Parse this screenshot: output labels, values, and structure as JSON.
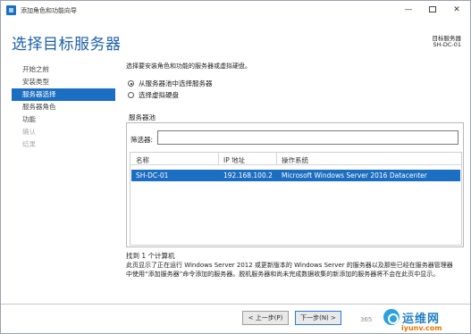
{
  "window": {
    "title": "添加角色和功能向导",
    "minimize": "—",
    "close": "✕"
  },
  "header": {
    "title": "选择目标服务器",
    "target_label": "目标服务器",
    "target_server": "SH-DC-01"
  },
  "nav": {
    "items": [
      {
        "label": "开始之前",
        "state": "normal"
      },
      {
        "label": "安装类型",
        "state": "normal"
      },
      {
        "label": "服务器选择",
        "state": "active"
      },
      {
        "label": "服务器角色",
        "state": "normal"
      },
      {
        "label": "功能",
        "state": "normal"
      },
      {
        "label": "确认",
        "state": "disabled"
      },
      {
        "label": "结果",
        "state": "disabled"
      }
    ]
  },
  "main": {
    "intro": "选择要安装角色和功能的服务器或虚拟硬盘。",
    "options": [
      {
        "label": "从服务器池中选择服务器",
        "checked": true
      },
      {
        "label": "选择虚拟硬盘",
        "checked": false
      }
    ],
    "pool_label": "服务器池",
    "filter_label": "筛选器:",
    "filter_value": "",
    "table": {
      "headers": [
        "名称",
        "IP 地址",
        "操作系统"
      ],
      "rows": [
        {
          "name": "SH-DC-01",
          "ip": "192.168.100.2",
          "os": "Microsoft Windows Server 2016 Datacenter",
          "selected": true
        }
      ]
    },
    "found": "找到 1 个计算机",
    "note": "此页显示了正在运行 Windows Server 2012 或更新版本的 Windows Server 的服务器以及那些已经在服务器管理器中使用“添加服务器”命令添加的服务器。脱机服务器和尚未完成数据收集的新添加的服务器将不会在此页中显示。"
  },
  "footer": {
    "prev": "< 上一步(P)",
    "next": "下一步(N) >"
  },
  "watermark": {
    "small": "365",
    "brand": "运维网",
    "site": "iyunv.com"
  },
  "colors": {
    "accent": "#1b6ec2",
    "title": "#1b5fa8"
  }
}
